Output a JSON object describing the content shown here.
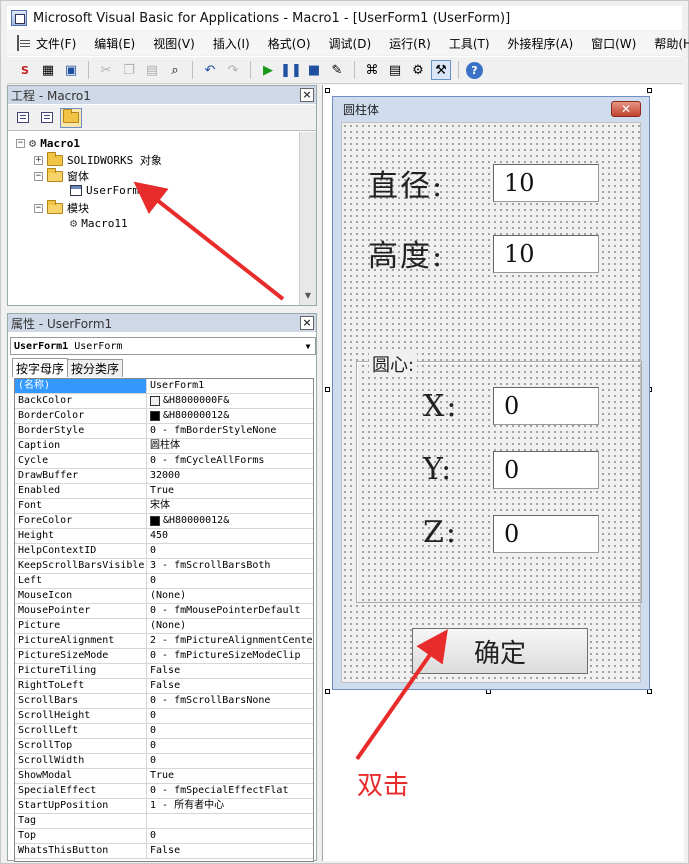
{
  "window": {
    "title": "Microsoft Visual Basic for Applications - Macro1 - [UserForm1 (UserForm)]"
  },
  "menu": [
    "文件(F)",
    "编辑(E)",
    "视图(V)",
    "插入(I)",
    "格式(O)",
    "调试(D)",
    "运行(R)",
    "工具(T)",
    "外接程序(A)",
    "窗口(W)",
    "帮助(H)"
  ],
  "project": {
    "title": "工程 - Macro1",
    "root": "Macro1",
    "solidworks": "SOLIDWORKS 对象",
    "forms": "窗体",
    "userform": "UserForm1",
    "modules": "模块",
    "module": "Macro11"
  },
  "properties": {
    "title": "属性 - UserForm1",
    "object_name": "UserForm1",
    "object_type": "UserForm",
    "tab_alpha": "按字母序",
    "tab_category": "按分类序",
    "rows": [
      {
        "name": "(名称)",
        "value": "UserForm1"
      },
      {
        "name": "BackColor",
        "value": "&H8000000F&",
        "swatch": "#f0f0f0"
      },
      {
        "name": "BorderColor",
        "value": "&H80000012&",
        "swatch": "#000000"
      },
      {
        "name": "BorderStyle",
        "value": "0 - fmBorderStyleNone"
      },
      {
        "name": "Caption",
        "value": "圆柱体"
      },
      {
        "name": "Cycle",
        "value": "0 - fmCycleAllForms"
      },
      {
        "name": "DrawBuffer",
        "value": "32000"
      },
      {
        "name": "Enabled",
        "value": "True"
      },
      {
        "name": "Font",
        "value": "宋体"
      },
      {
        "name": "ForeColor",
        "value": "&H80000012&",
        "swatch": "#000000"
      },
      {
        "name": "Height",
        "value": "450"
      },
      {
        "name": "HelpContextID",
        "value": "0"
      },
      {
        "name": "KeepScrollBarsVisible",
        "value": "3 - fmScrollBarsBoth"
      },
      {
        "name": "Left",
        "value": "0"
      },
      {
        "name": "MouseIcon",
        "value": "(None)"
      },
      {
        "name": "MousePointer",
        "value": "0 - fmMousePointerDefault"
      },
      {
        "name": "Picture",
        "value": "(None)"
      },
      {
        "name": "PictureAlignment",
        "value": "2 - fmPictureAlignmentCente"
      },
      {
        "name": "PictureSizeMode",
        "value": "0 - fmPictureSizeModeClip"
      },
      {
        "name": "PictureTiling",
        "value": "False"
      },
      {
        "name": "RightToLeft",
        "value": "False"
      },
      {
        "name": "ScrollBars",
        "value": "0 - fmScrollBarsNone"
      },
      {
        "name": "ScrollHeight",
        "value": "0"
      },
      {
        "name": "ScrollLeft",
        "value": "0"
      },
      {
        "name": "ScrollTop",
        "value": "0"
      },
      {
        "name": "ScrollWidth",
        "value": "0"
      },
      {
        "name": "ShowModal",
        "value": "True"
      },
      {
        "name": "SpecialEffect",
        "value": "0 - fmSpecialEffectFlat"
      },
      {
        "name": "StartUpPosition",
        "value": "1 - 所有者中心"
      },
      {
        "name": "Tag",
        "value": ""
      },
      {
        "name": "Top",
        "value": "0"
      },
      {
        "name": "WhatsThisButton",
        "value": "False"
      }
    ]
  },
  "form": {
    "caption": "圆柱体",
    "diameter_label": "直径:",
    "diameter_value": "10",
    "height_label": "高度:",
    "height_value": "10",
    "center_caption": "圆心:",
    "x_label": "X:",
    "x_value": "0",
    "y_label": "Y:",
    "y_value": "0",
    "z_label": "Z:",
    "z_value": "0",
    "ok_label": "确定"
  },
  "annotation": {
    "text": "双击",
    "color": "#e82c2c"
  }
}
